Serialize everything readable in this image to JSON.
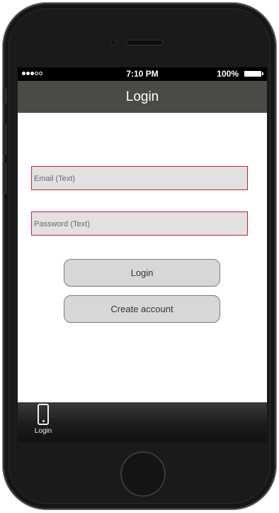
{
  "status_bar": {
    "time": "7:10 PM",
    "battery": "100%"
  },
  "nav": {
    "title": "Login"
  },
  "form": {
    "email_placeholder": "Email (Text)",
    "password_placeholder": "Password (Text)",
    "login_label": "Login",
    "create_account_label": "Create account"
  },
  "tab_bar": {
    "items": [
      {
        "label": "Login",
        "icon": "phone-icon"
      }
    ]
  },
  "colors": {
    "nav_bg": "#4a4a47",
    "field_border": "#c8202c",
    "field_bg": "#e1e1e1",
    "button_bg": "#d7d7d7"
  }
}
